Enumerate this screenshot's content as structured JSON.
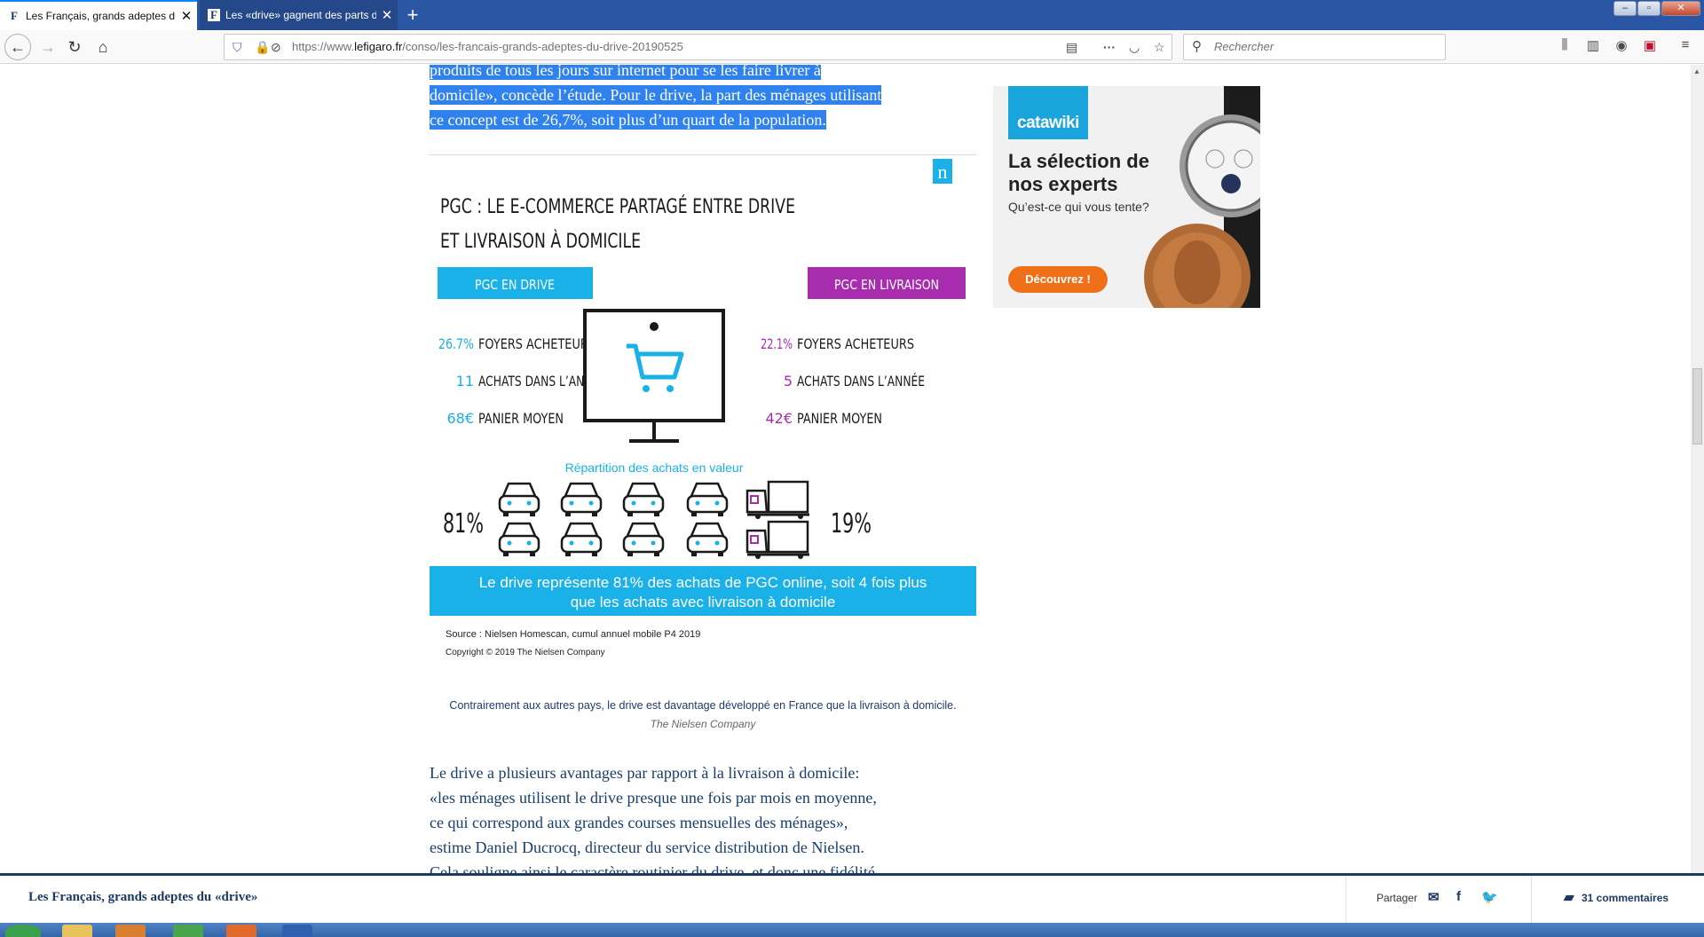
{
  "browser": {
    "tabs": [
      {
        "title": "Les Français, grands adeptes du",
        "favicon": "F",
        "active": true
      },
      {
        "title": "Les «drive» gagnent des parts d",
        "favicon": "F",
        "active": false
      }
    ],
    "url_prefix": "https://www.",
    "url_domain": "lefigaro.fr",
    "url_path": "/conso/les-francais-grands-adeptes-du-drive-20190525",
    "search_placeholder": "Rechercher"
  },
  "article": {
    "selected_lines": [
      "produits de tous les jours sur internet pour se les faire livrer à",
      "domicile», concède l’étude. Pour le drive, la part des ménages utilisant",
      "ce concept est de 26,7%, soit plus d’un quart de la population."
    ],
    "caption": "Contrairement aux autres pays, le drive est davantage développé en France que la livraison à domicile.",
    "credit": "The Nielsen Company",
    "body_lines": [
      "Le drive a plusieurs avantages par rapport à la livraison à domicile:",
      "«les ménages utilisent le drive presque une fois par mois en moyenne,",
      "ce qui correspond aux grandes courses mensuelles des ménages»,",
      "estime Daniel Ducrocq, directeur du service distribution de Nielsen.",
      "Cela souligne ainsi le caractère routinier du drive, et donc une fidélité"
    ]
  },
  "infographic": {
    "logo": "n",
    "title_line1": "PGC : LE E-COMMERCE  PARTAGÉ ENTRE DRIVE",
    "title_line2": "ET LIVRAISON À DOMICILE",
    "left_badge": "PGC EN DRIVE",
    "right_badge": "PGC EN LIVRAISON",
    "left_stats": [
      {
        "value": "26.7%",
        "label": "FOYERS ACHETEURS"
      },
      {
        "value": "11",
        "label": "ACHATS DANS L’ANNÉE"
      },
      {
        "value": "68€",
        "label": "PANIER MOYEN"
      }
    ],
    "right_stats": [
      {
        "value": "22.1%",
        "label": "FOYERS ACHETEURS"
      },
      {
        "value": "5",
        "label": "ACHATS DANS L’ANNÉE"
      },
      {
        "value": "42€",
        "label": "PANIER MOYEN"
      }
    ],
    "repartition_label": "Répartition des achats en valeur",
    "drive_share": "81%",
    "delivery_share": "19%",
    "banner_line1": "Le drive représente 81% des achats de PGC online, soit 4 fois plus",
    "banner_line2": "que les achats avec livraison à domicile",
    "source": "Source : Nielsen Homescan, cumul annuel mobile P4 2019",
    "copyright": "Copyright © 2019 The Nielsen Company",
    "colors": {
      "drive": "#1ab1e8",
      "delivery": "#a72cae",
      "dark": "#1a1a1a"
    }
  },
  "ad": {
    "logo": "catawiki",
    "headline": "La sélection de nos experts",
    "sub": "Qu’est-ce qui vous tente?",
    "cta": "Découvrez !"
  },
  "sticky": {
    "title": "Les Français, grands adeptes du «drive»",
    "share_label": "Partager",
    "comments": "31 commentaires"
  }
}
